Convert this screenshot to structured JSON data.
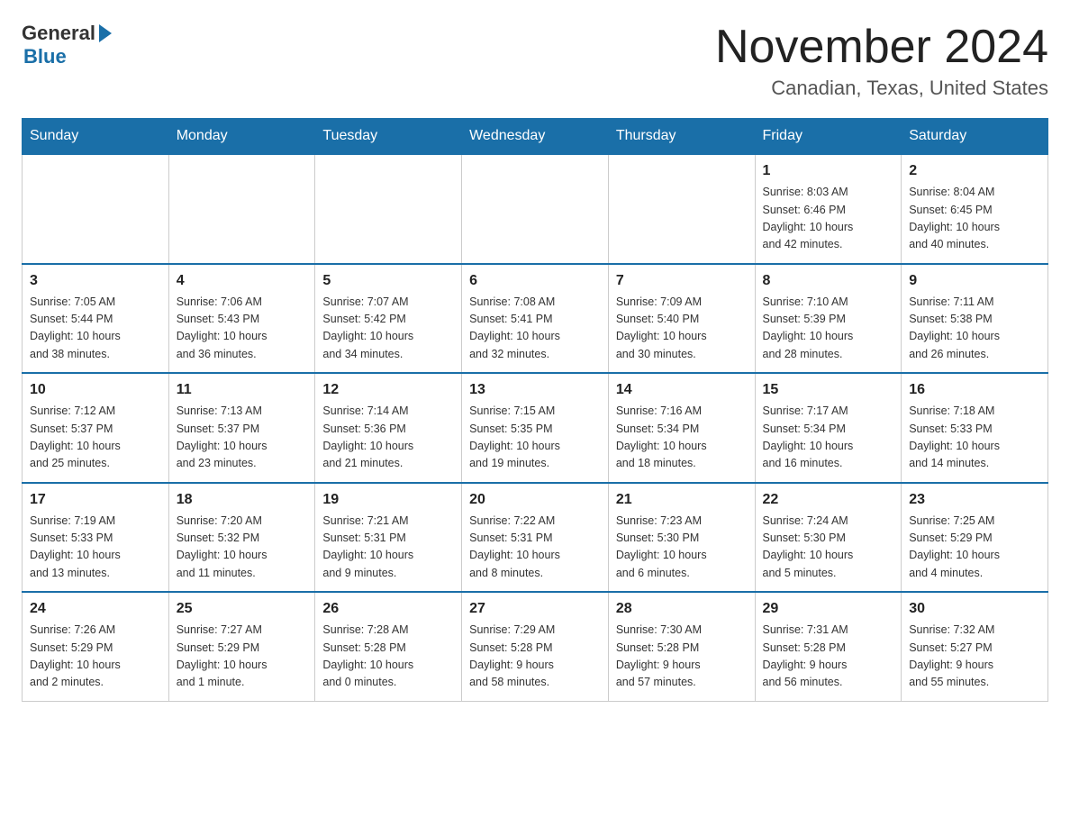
{
  "header": {
    "logo_general": "General",
    "logo_blue": "Blue",
    "title": "November 2024",
    "subtitle": "Canadian, Texas, United States"
  },
  "days_of_week": [
    "Sunday",
    "Monday",
    "Tuesday",
    "Wednesday",
    "Thursday",
    "Friday",
    "Saturday"
  ],
  "weeks": [
    [
      {
        "day": "",
        "info": ""
      },
      {
        "day": "",
        "info": ""
      },
      {
        "day": "",
        "info": ""
      },
      {
        "day": "",
        "info": ""
      },
      {
        "day": "",
        "info": ""
      },
      {
        "day": "1",
        "info": "Sunrise: 8:03 AM\nSunset: 6:46 PM\nDaylight: 10 hours\nand 42 minutes."
      },
      {
        "day": "2",
        "info": "Sunrise: 8:04 AM\nSunset: 6:45 PM\nDaylight: 10 hours\nand 40 minutes."
      }
    ],
    [
      {
        "day": "3",
        "info": "Sunrise: 7:05 AM\nSunset: 5:44 PM\nDaylight: 10 hours\nand 38 minutes."
      },
      {
        "day": "4",
        "info": "Sunrise: 7:06 AM\nSunset: 5:43 PM\nDaylight: 10 hours\nand 36 minutes."
      },
      {
        "day": "5",
        "info": "Sunrise: 7:07 AM\nSunset: 5:42 PM\nDaylight: 10 hours\nand 34 minutes."
      },
      {
        "day": "6",
        "info": "Sunrise: 7:08 AM\nSunset: 5:41 PM\nDaylight: 10 hours\nand 32 minutes."
      },
      {
        "day": "7",
        "info": "Sunrise: 7:09 AM\nSunset: 5:40 PM\nDaylight: 10 hours\nand 30 minutes."
      },
      {
        "day": "8",
        "info": "Sunrise: 7:10 AM\nSunset: 5:39 PM\nDaylight: 10 hours\nand 28 minutes."
      },
      {
        "day": "9",
        "info": "Sunrise: 7:11 AM\nSunset: 5:38 PM\nDaylight: 10 hours\nand 26 minutes."
      }
    ],
    [
      {
        "day": "10",
        "info": "Sunrise: 7:12 AM\nSunset: 5:37 PM\nDaylight: 10 hours\nand 25 minutes."
      },
      {
        "day": "11",
        "info": "Sunrise: 7:13 AM\nSunset: 5:37 PM\nDaylight: 10 hours\nand 23 minutes."
      },
      {
        "day": "12",
        "info": "Sunrise: 7:14 AM\nSunset: 5:36 PM\nDaylight: 10 hours\nand 21 minutes."
      },
      {
        "day": "13",
        "info": "Sunrise: 7:15 AM\nSunset: 5:35 PM\nDaylight: 10 hours\nand 19 minutes."
      },
      {
        "day": "14",
        "info": "Sunrise: 7:16 AM\nSunset: 5:34 PM\nDaylight: 10 hours\nand 18 minutes."
      },
      {
        "day": "15",
        "info": "Sunrise: 7:17 AM\nSunset: 5:34 PM\nDaylight: 10 hours\nand 16 minutes."
      },
      {
        "day": "16",
        "info": "Sunrise: 7:18 AM\nSunset: 5:33 PM\nDaylight: 10 hours\nand 14 minutes."
      }
    ],
    [
      {
        "day": "17",
        "info": "Sunrise: 7:19 AM\nSunset: 5:33 PM\nDaylight: 10 hours\nand 13 minutes."
      },
      {
        "day": "18",
        "info": "Sunrise: 7:20 AM\nSunset: 5:32 PM\nDaylight: 10 hours\nand 11 minutes."
      },
      {
        "day": "19",
        "info": "Sunrise: 7:21 AM\nSunset: 5:31 PM\nDaylight: 10 hours\nand 9 minutes."
      },
      {
        "day": "20",
        "info": "Sunrise: 7:22 AM\nSunset: 5:31 PM\nDaylight: 10 hours\nand 8 minutes."
      },
      {
        "day": "21",
        "info": "Sunrise: 7:23 AM\nSunset: 5:30 PM\nDaylight: 10 hours\nand 6 minutes."
      },
      {
        "day": "22",
        "info": "Sunrise: 7:24 AM\nSunset: 5:30 PM\nDaylight: 10 hours\nand 5 minutes."
      },
      {
        "day": "23",
        "info": "Sunrise: 7:25 AM\nSunset: 5:29 PM\nDaylight: 10 hours\nand 4 minutes."
      }
    ],
    [
      {
        "day": "24",
        "info": "Sunrise: 7:26 AM\nSunset: 5:29 PM\nDaylight: 10 hours\nand 2 minutes."
      },
      {
        "day": "25",
        "info": "Sunrise: 7:27 AM\nSunset: 5:29 PM\nDaylight: 10 hours\nand 1 minute."
      },
      {
        "day": "26",
        "info": "Sunrise: 7:28 AM\nSunset: 5:28 PM\nDaylight: 10 hours\nand 0 minutes."
      },
      {
        "day": "27",
        "info": "Sunrise: 7:29 AM\nSunset: 5:28 PM\nDaylight: 9 hours\nand 58 minutes."
      },
      {
        "day": "28",
        "info": "Sunrise: 7:30 AM\nSunset: 5:28 PM\nDaylight: 9 hours\nand 57 minutes."
      },
      {
        "day": "29",
        "info": "Sunrise: 7:31 AM\nSunset: 5:28 PM\nDaylight: 9 hours\nand 56 minutes."
      },
      {
        "day": "30",
        "info": "Sunrise: 7:32 AM\nSunset: 5:27 PM\nDaylight: 9 hours\nand 55 minutes."
      }
    ]
  ]
}
